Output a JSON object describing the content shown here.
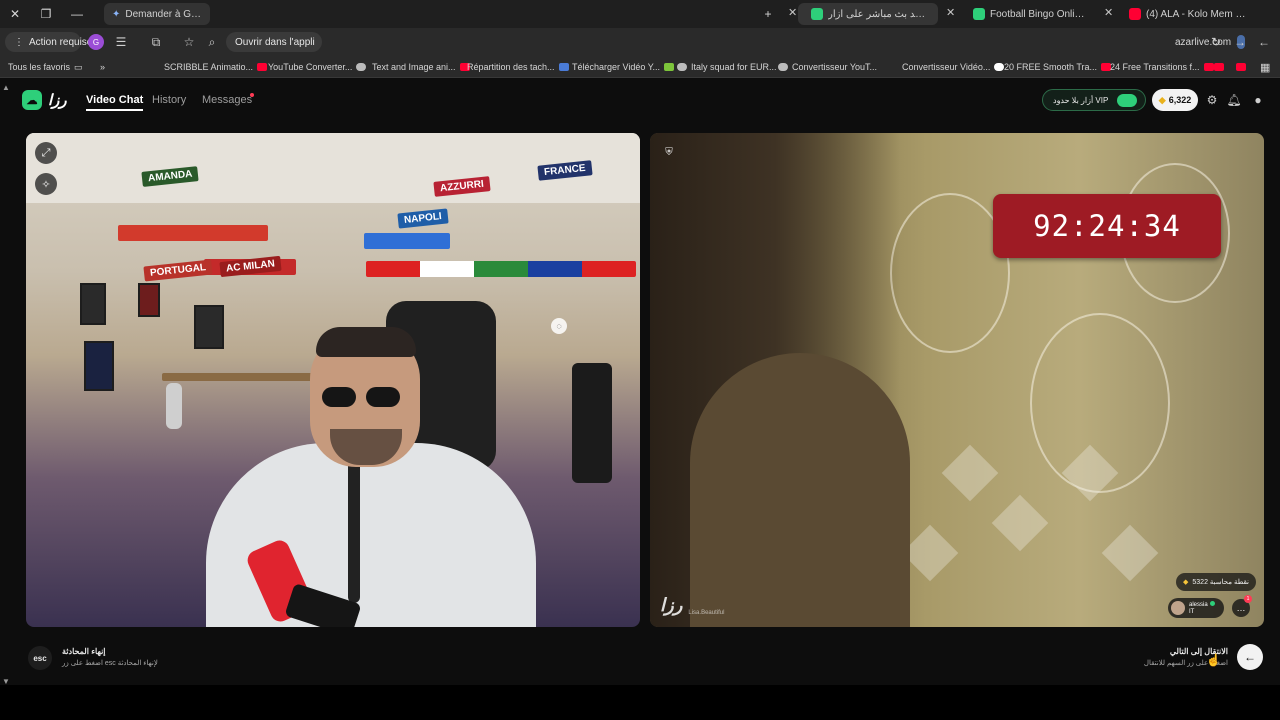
{
  "browser": {
    "tabs": [
      {
        "title": "(4) ALA - Kolo Mem (Official M",
        "fav_color": "#ff0033"
      },
      {
        "title": "Football Bingo Online - Play N",
        "fav_color": "#2ecf7a"
      },
      {
        "title": "شاهد بث مباشر على أزار",
        "fav_color": "#2ecf7a"
      }
    ],
    "gemini_label": "Demander à Gemini",
    "address": "azarlive.com",
    "open_app_label": "Ouvrir dans l'appli",
    "action_required_label": "Action requise",
    "profile_initial": "G",
    "bookmarks": [
      {
        "label": "24 Free Transitions f..."
      },
      {
        "label": "20 FREE Smooth Tra..."
      },
      {
        "label": "Convertisseur Vidéo..."
      },
      {
        "label": "Convertisseur YouT..."
      },
      {
        "label": "Italy squad for EUR..."
      },
      {
        "label": "Télécharger Vidéo Y..."
      },
      {
        "label": "Répartition des tach..."
      },
      {
        "label": "Text and Image ani..."
      },
      {
        "label": "YouTube Converter..."
      },
      {
        "label": "SCRIBBLE Animatio..."
      }
    ],
    "all_favorites_label": "Tous les favoris",
    "more_label": "»"
  },
  "site": {
    "logo_text": "رزا",
    "nav": {
      "video_chat": "Video Chat",
      "history": "History",
      "messages": "Messages"
    },
    "vip_label": "أزار بلا حدود VIP",
    "coins": "6,322"
  },
  "left_panel": {
    "banners": [
      "AMANDA",
      "FRANCE",
      "AZZURRI",
      "NAPOLI",
      "AC MILAN",
      "PORTUGAL"
    ]
  },
  "right_panel": {
    "timer": "92:24:34",
    "watermark_logo": "رزا",
    "watermark_handle": "Lisa.Beautiful",
    "gift_label": "5322 نقطة محاسبة",
    "user_name": "alessia",
    "user_country": "IT",
    "chat_badge": "1"
  },
  "footer": {
    "esc_label": "esc",
    "esc_title": "إنهاء المحادثة",
    "esc_sub": "اضغط على زر esc لإنهاء المحادثة",
    "next_title": "الانتقال إلى التالي",
    "next_sub": "اضغط على زر السهم للانتقال"
  }
}
